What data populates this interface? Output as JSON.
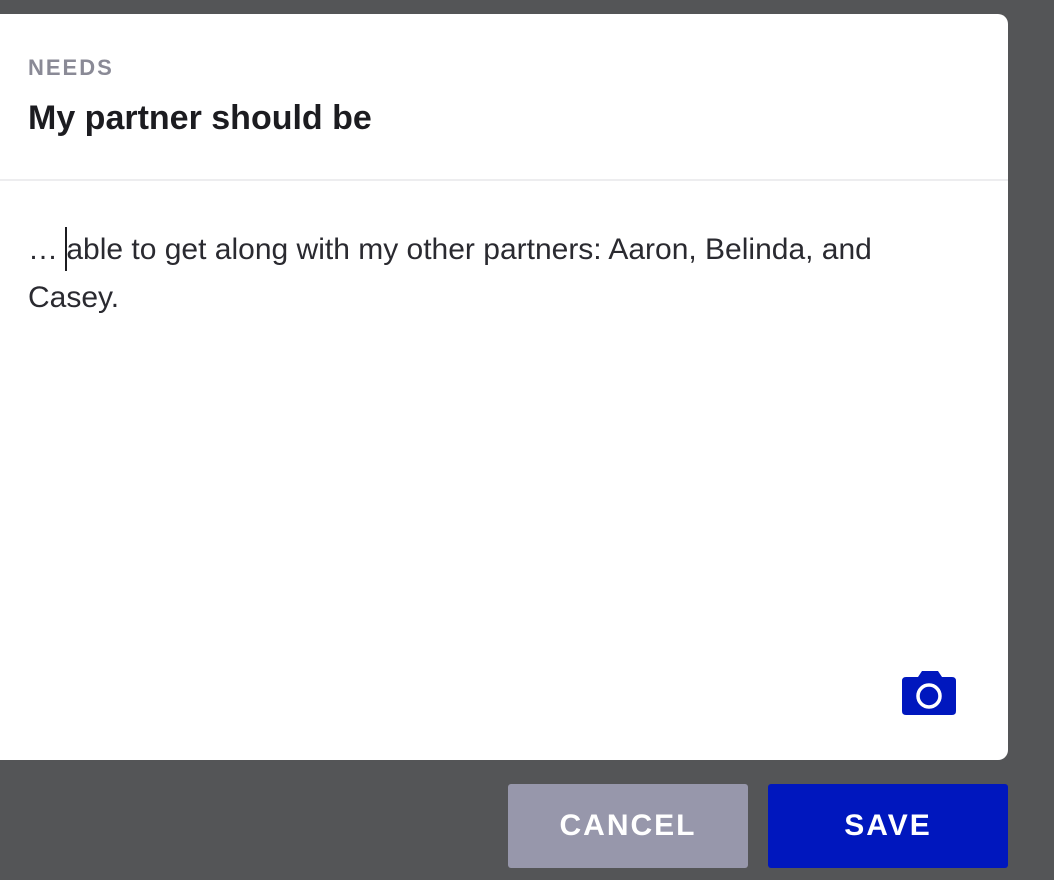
{
  "header": {
    "section_label": "NEEDS",
    "title": "My partner should be"
  },
  "answer": {
    "prefix": "… ",
    "text": "able to get along with my other partners: Aaron, Belinda, and Casey."
  },
  "actions": {
    "cancel_label": "CANCEL",
    "save_label": "SAVE"
  },
  "icons": {
    "camera": "camera-icon"
  },
  "colors": {
    "accent": "#0017be",
    "cancel": "#9797ab",
    "backdrop": "#545557"
  }
}
